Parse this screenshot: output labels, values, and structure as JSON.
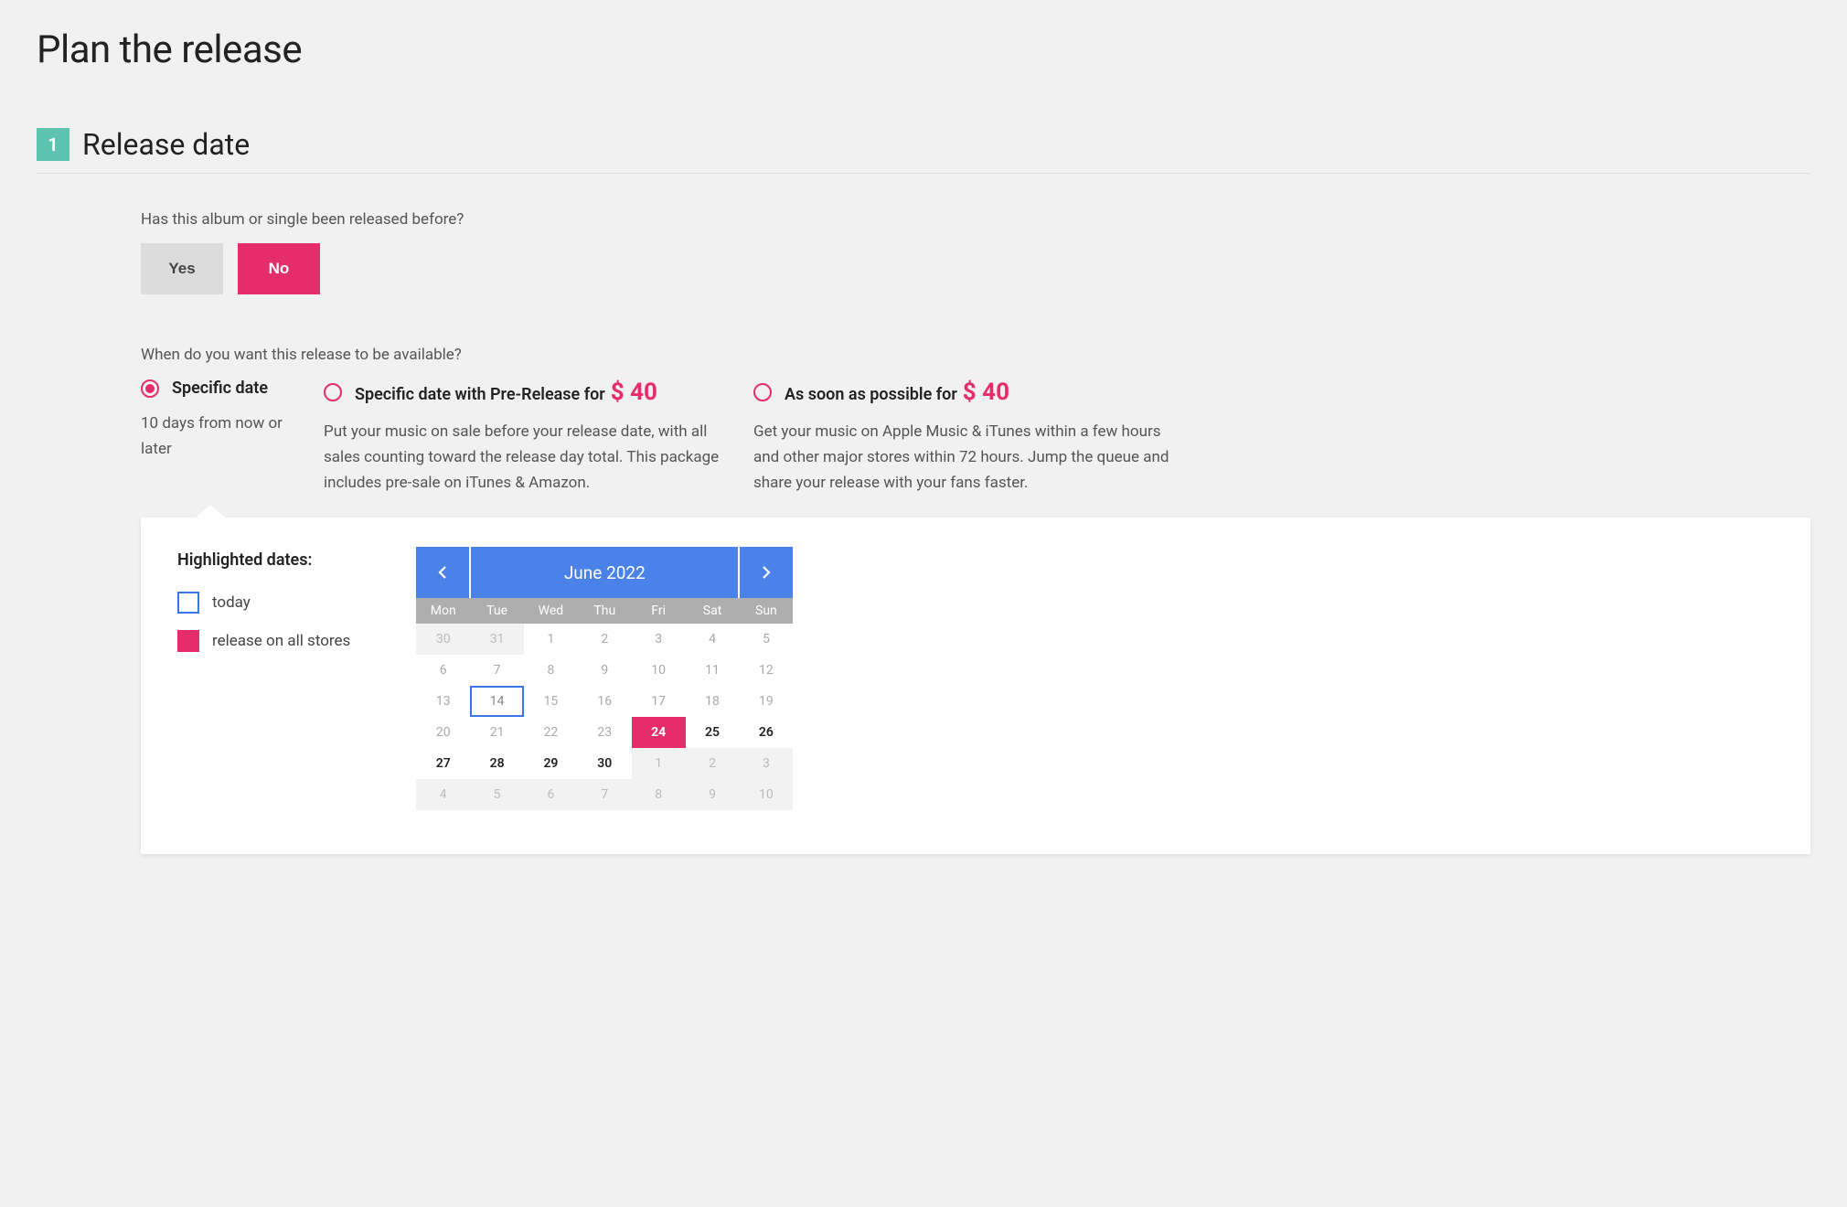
{
  "page_title": "Plan the release",
  "section": {
    "number": "1",
    "title": "Release date"
  },
  "q1": {
    "prompt": "Has this album or single been released before?",
    "yes": "Yes",
    "no": "No"
  },
  "q2": {
    "prompt": "When do you want this release to be available?",
    "options": [
      {
        "label": "Specific date",
        "price": "",
        "desc": "10 days from now or later"
      },
      {
        "label": "Specific date with Pre-Release for",
        "price": "$ 40",
        "desc": "Put your music on sale before your release date, with all sales counting toward the release day total. This package includes pre-sale on iTunes & Amazon."
      },
      {
        "label": "As soon as possible for",
        "price": "$ 40",
        "desc": "Get your music on Apple Music & iTunes within a few hours and other major stores within 72 hours. Jump the queue and share your release with your fans faster."
      }
    ]
  },
  "legend": {
    "title": "Highlighted dates:",
    "today": "today",
    "release": "release on all stores"
  },
  "calendar": {
    "month_label": "June 2022",
    "weekdays": [
      "Mon",
      "Tue",
      "Wed",
      "Thu",
      "Fri",
      "Sat",
      "Sun"
    ],
    "grid": [
      [
        {
          "n": "30",
          "cls": "other-month"
        },
        {
          "n": "31",
          "cls": "other-month"
        },
        {
          "n": "1",
          "cls": ""
        },
        {
          "n": "2",
          "cls": ""
        },
        {
          "n": "3",
          "cls": ""
        },
        {
          "n": "4",
          "cls": ""
        },
        {
          "n": "5",
          "cls": ""
        }
      ],
      [
        {
          "n": "6",
          "cls": ""
        },
        {
          "n": "7",
          "cls": ""
        },
        {
          "n": "8",
          "cls": ""
        },
        {
          "n": "9",
          "cls": ""
        },
        {
          "n": "10",
          "cls": ""
        },
        {
          "n": "11",
          "cls": ""
        },
        {
          "n": "12",
          "cls": ""
        }
      ],
      [
        {
          "n": "13",
          "cls": ""
        },
        {
          "n": "14",
          "cls": "today"
        },
        {
          "n": "15",
          "cls": ""
        },
        {
          "n": "16",
          "cls": ""
        },
        {
          "n": "17",
          "cls": ""
        },
        {
          "n": "18",
          "cls": ""
        },
        {
          "n": "19",
          "cls": ""
        }
      ],
      [
        {
          "n": "20",
          "cls": ""
        },
        {
          "n": "21",
          "cls": ""
        },
        {
          "n": "22",
          "cls": ""
        },
        {
          "n": "23",
          "cls": ""
        },
        {
          "n": "24",
          "cls": "release"
        },
        {
          "n": "25",
          "cls": "bold"
        },
        {
          "n": "26",
          "cls": "bold"
        }
      ],
      [
        {
          "n": "27",
          "cls": "bold"
        },
        {
          "n": "28",
          "cls": "bold"
        },
        {
          "n": "29",
          "cls": "bold"
        },
        {
          "n": "30",
          "cls": "bold"
        },
        {
          "n": "1",
          "cls": "other-month"
        },
        {
          "n": "2",
          "cls": "other-month"
        },
        {
          "n": "3",
          "cls": "other-month"
        }
      ],
      [
        {
          "n": "4",
          "cls": "other-month"
        },
        {
          "n": "5",
          "cls": "other-month"
        },
        {
          "n": "6",
          "cls": "other-month"
        },
        {
          "n": "7",
          "cls": "other-month"
        },
        {
          "n": "8",
          "cls": "other-month"
        },
        {
          "n": "9",
          "cls": "other-month"
        },
        {
          "n": "10",
          "cls": "other-month"
        }
      ]
    ]
  }
}
